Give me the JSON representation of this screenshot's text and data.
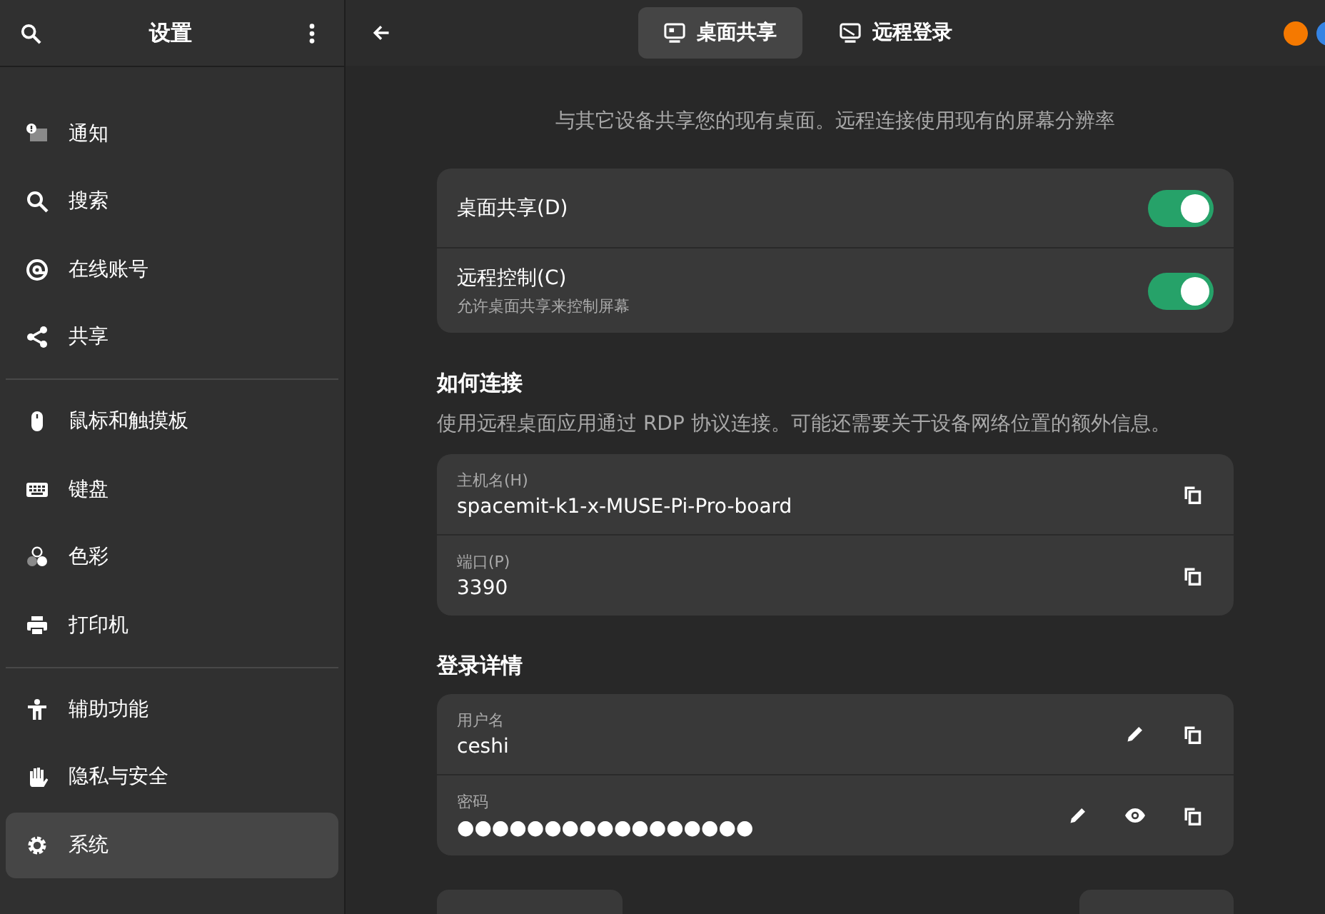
{
  "sidebar": {
    "title": "设置",
    "groups": [
      [
        {
          "label": "通知",
          "selected": false
        },
        {
          "label": "搜索",
          "selected": false
        },
        {
          "label": "在线账号",
          "selected": false
        },
        {
          "label": "共享",
          "selected": false
        }
      ],
      [
        {
          "label": "鼠标和触摸板",
          "selected": false
        },
        {
          "label": "键盘",
          "selected": false
        },
        {
          "label": "色彩",
          "selected": false
        },
        {
          "label": "打印机",
          "selected": false
        }
      ],
      [
        {
          "label": "辅助功能",
          "selected": false
        },
        {
          "label": "隐私与安全",
          "selected": false
        },
        {
          "label": "系统",
          "selected": true
        }
      ]
    ]
  },
  "tabs": [
    {
      "label": "桌面共享",
      "selected": true
    },
    {
      "label": "远程登录",
      "selected": false
    }
  ],
  "description": "与其它设备共享您的现有桌面。远程连接使用现有的屏幕分辨率",
  "switches": [
    {
      "label": "桌面共享(D)",
      "on": true
    },
    {
      "label": "远程控制(C)",
      "subtitle": "允许桌面共享来控制屏幕",
      "on": true
    }
  ],
  "sections": [
    {
      "title": "如何连接",
      "subtitle": "使用远程桌面应用通过 RDP 协议连接。可能还需要关于设备网络位置的额外信息。",
      "rows": [
        {
          "label": "主机名(H)",
          "value": "spacemit-k1-x-MUSE-Pi-Pro-board",
          "editable": false,
          "revealable": false
        },
        {
          "label": "端口(P)",
          "value": "3390",
          "editable": false,
          "revealable": false
        }
      ]
    },
    {
      "title": "登录详情",
      "rows": [
        {
          "label": "用户名",
          "value": "ceshi",
          "editable": true,
          "revealable": false
        },
        {
          "label": "密码",
          "value": "●●●●●●●●●●●●●●●●●",
          "editable": true,
          "revealable": true
        }
      ]
    }
  ]
}
